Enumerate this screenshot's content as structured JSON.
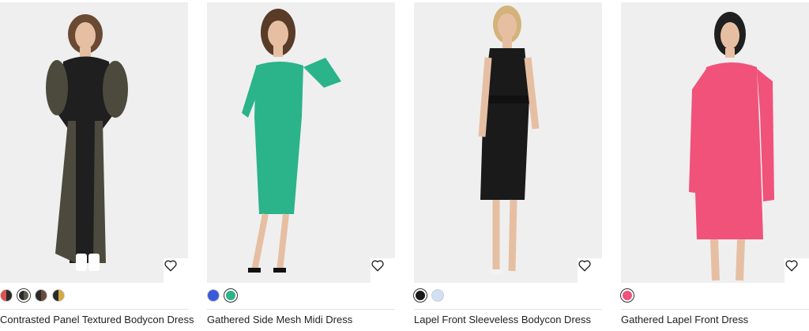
{
  "products": [
    {
      "title": "Contrasted Panel Textured Bodycon Dress",
      "wishlist_icon": "heart-outline-icon",
      "swatches": [
        "red/black",
        "black/olive",
        "black/brown",
        "black/mustard"
      ]
    },
    {
      "title": "Gathered Side Mesh Midi Dress",
      "wishlist_icon": "heart-outline-icon",
      "swatches": [
        "royal blue",
        "green"
      ]
    },
    {
      "title": "Lapel Front Sleeveless Bodycon Dress",
      "wishlist_icon": "heart-outline-icon",
      "swatches": [
        "black",
        "pale blue"
      ]
    },
    {
      "title": "Gathered Lapel Front Dress",
      "wishlist_icon": "heart-outline-icon",
      "swatches": [
        "pink"
      ]
    }
  ],
  "colors": {
    "title_text": "#222222",
    "image_bg": "#efefef",
    "dress_black": "#1a1a1a",
    "dress_olive": "#4c4a3c",
    "dress_green": "#2bb38a",
    "dress_pink": "#f0527a",
    "skin": "#e6bfa3",
    "hair": "#5a3b28"
  }
}
